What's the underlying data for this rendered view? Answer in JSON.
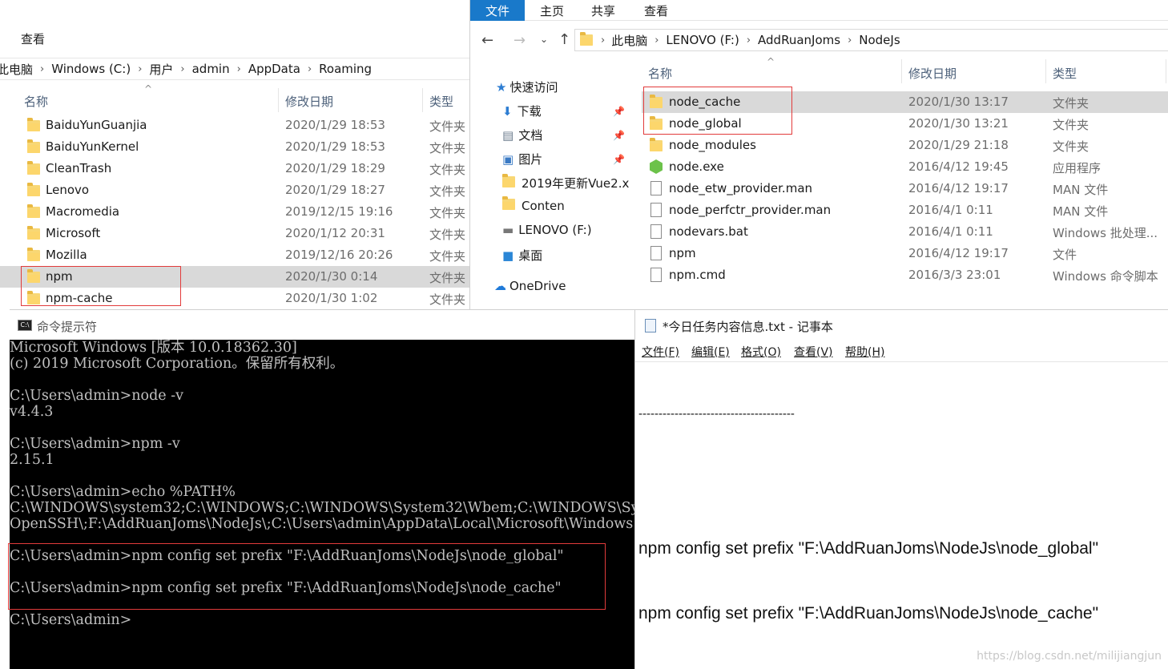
{
  "explorer_left": {
    "menu": "查看",
    "breadcrumb": [
      "此电脑",
      "Windows (C:)",
      "用户",
      "admin",
      "AppData",
      "Roaming"
    ],
    "columns": {
      "name": "名称",
      "date": "修改日期",
      "type": "类型"
    },
    "rows": [
      {
        "name": "BaiduYunGuanjia",
        "date": "2020/1/29 18:53",
        "type": "文件夹"
      },
      {
        "name": "BaiduYunKernel",
        "date": "2020/1/29 18:53",
        "type": "文件夹"
      },
      {
        "name": "CleanTrash",
        "date": "2020/1/29 18:29",
        "type": "文件夹"
      },
      {
        "name": "Lenovo",
        "date": "2020/1/29 18:27",
        "type": "文件夹"
      },
      {
        "name": "Macromedia",
        "date": "2019/12/15 19:16",
        "type": "文件夹"
      },
      {
        "name": "Microsoft",
        "date": "2020/1/12 20:31",
        "type": "文件夹"
      },
      {
        "name": "Mozilla",
        "date": "2019/12/16 20:26",
        "type": "文件夹"
      },
      {
        "name": "npm",
        "date": "2020/1/30 0:14",
        "type": "文件夹"
      },
      {
        "name": "npm-cache",
        "date": "2020/1/30 1:02",
        "type": "文件夹"
      }
    ]
  },
  "explorer_right": {
    "tabs": [
      "文件",
      "主页",
      "共享",
      "查看"
    ],
    "breadcrumb": [
      "此电脑",
      "LENOVO (F:)",
      "AddRuanJoms",
      "NodeJs"
    ],
    "nav": [
      {
        "label": "快速访问",
        "icon": "star-icon"
      },
      {
        "label": "下载",
        "icon": "download-icon"
      },
      {
        "label": "文档",
        "icon": "document-icon"
      },
      {
        "label": "图片",
        "icon": "picture-icon"
      },
      {
        "label": "2019年更新Vue2.x",
        "icon": "folder-icon"
      },
      {
        "label": "Conten",
        "icon": "folder-icon"
      },
      {
        "label": "LENOVO (F:)",
        "icon": "drive-icon"
      },
      {
        "label": "桌面",
        "icon": "desktop-icon"
      },
      {
        "label": "OneDrive",
        "icon": "cloud-icon"
      }
    ],
    "columns": {
      "name": "名称",
      "date": "修改日期",
      "type": "类型"
    },
    "rows": [
      {
        "name": "node_cache",
        "date": "2020/1/30 13:17",
        "type": "文件夹",
        "icon": "folder-icon"
      },
      {
        "name": "node_global",
        "date": "2020/1/30 13:21",
        "type": "文件夹",
        "icon": "folder-icon"
      },
      {
        "name": "node_modules",
        "date": "2020/1/29 21:18",
        "type": "文件夹",
        "icon": "folder-icon"
      },
      {
        "name": "node.exe",
        "date": "2016/4/12 19:45",
        "type": "应用程序",
        "icon": "nodejs-icon"
      },
      {
        "name": "node_etw_provider.man",
        "date": "2016/4/12 19:17",
        "type": "MAN 文件",
        "icon": "file-icon"
      },
      {
        "name": "node_perfctr_provider.man",
        "date": "2016/4/1 0:11",
        "type": "MAN 文件",
        "icon": "file-icon"
      },
      {
        "name": "nodevars.bat",
        "date": "2016/4/1 0:11",
        "type": "Windows 批处理...",
        "icon": "bat-file-icon"
      },
      {
        "name": "npm",
        "date": "2016/4/12 19:17",
        "type": "文件",
        "icon": "file-icon"
      },
      {
        "name": "npm.cmd",
        "date": "2016/3/3 23:01",
        "type": "Windows 命令脚本",
        "icon": "cmd-file-icon"
      }
    ]
  },
  "cmd": {
    "title": "命令提示符",
    "lines": [
      "Microsoft Windows [版本 10.0.18362.30]",
      "(c) 2019 Microsoft Corporation。保留所有权利。",
      "",
      "C:\\Users\\admin>node -v",
      "v4.4.3",
      "",
      "C:\\Users\\admin>npm -v",
      "2.15.1",
      "",
      "C:\\Users\\admin>echo %PATH%",
      "C:\\WINDOWS\\system32;C:\\WINDOWS;C:\\WINDOWS\\System32\\Wbem;C:\\WINDOWS\\System32\\Wi",
      "OpenSSH\\;F:\\AddRuanJoms\\NodeJs\\;C:\\Users\\admin\\AppData\\Local\\Microsoft\\Windows",
      "",
      "C:\\Users\\admin>npm config set prefix \"F:\\AddRuanJoms\\NodeJs\\node_global\"",
      "",
      "C:\\Users\\admin>npm config set prefix \"F:\\AddRuanJoms\\NodeJs\\node_cache\"",
      "",
      "C:\\Users\\admin>"
    ]
  },
  "notepad": {
    "title": "*今日任务内容信息.txt - 记事本",
    "menu": [
      "文件(F)",
      "编辑(E)",
      "格式(O)",
      "查看(V)",
      "帮助(H)"
    ],
    "lines": [
      "---------------------------------------",
      "",
      "npm config set prefix \"F:\\AddRuanJoms\\NodeJs\\node_global\"",
      "npm config set prefix \"F:\\AddRuanJoms\\NodeJs\\node_cache\""
    ]
  },
  "watermark": "https://blog.csdn.net/milijiangjun",
  "colors": {
    "accent": "#1979ca",
    "highlight": "#e23b3b",
    "selected": "#d9d9d9"
  }
}
